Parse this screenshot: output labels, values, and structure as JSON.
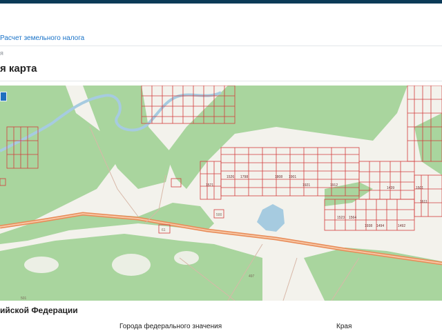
{
  "header": {
    "link_text": "Расчет земельного налога"
  },
  "breadcrumb": {
    "text": "я"
  },
  "page": {
    "title": "я карта"
  },
  "map": {
    "lot_labels": [
      "1526",
      "1798",
      "1808",
      "1901",
      "1921",
      "1912",
      "1938",
      "1501",
      "1492",
      "1494",
      "1523",
      "1571",
      "1564",
      "1439",
      "1611"
    ],
    "road_labels": [
      "497",
      "501",
      "500",
      "61"
    ],
    "colors": {
      "forest": "#a9d59e",
      "field": "#f3f2ec",
      "lots": "#d23b3b",
      "river": "#a6cbe0",
      "road": "#e88a56"
    }
  },
  "section": {
    "title": "ийской Федерации",
    "columns": [
      "Города федерального значения",
      "Края"
    ]
  }
}
